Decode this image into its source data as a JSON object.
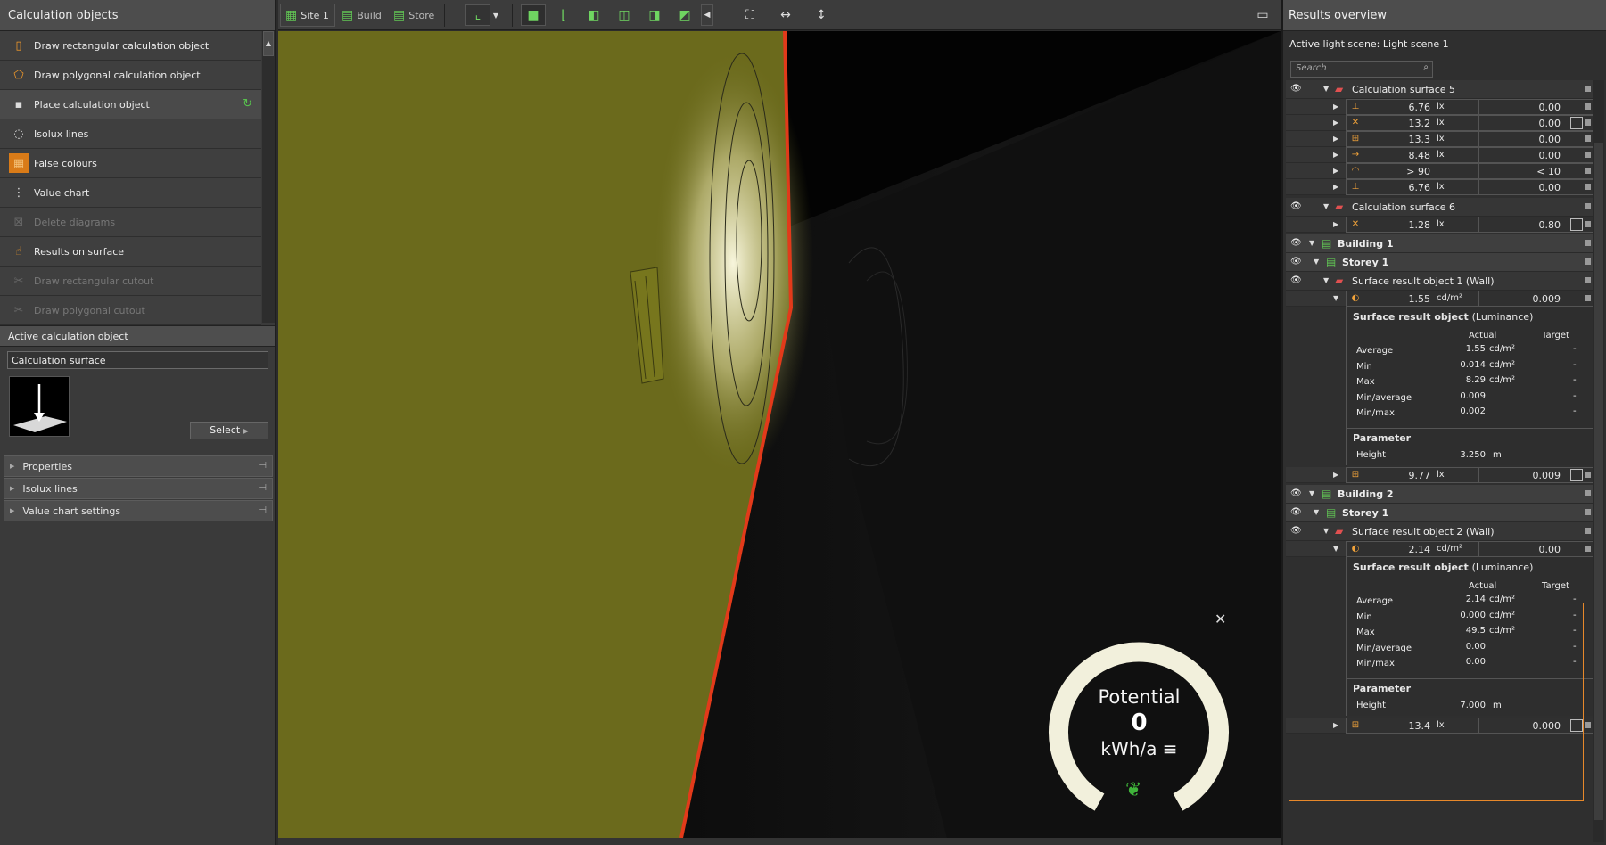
{
  "left": {
    "title": "Calculation objects",
    "tools": [
      {
        "label": "Draw rectangular calculation object",
        "icon": "rect-calc-icon",
        "enabled": true
      },
      {
        "label": "Draw polygonal calculation object",
        "icon": "polygon-calc-icon",
        "enabled": true
      },
      {
        "label": "Place calculation object",
        "icon": "place-icon",
        "enabled": true,
        "selected": true
      },
      {
        "label": "Isolux lines",
        "icon": "isolux-icon",
        "enabled": true
      },
      {
        "label": "False colours",
        "icon": "false-colours-icon",
        "enabled": true
      },
      {
        "label": "Value chart",
        "icon": "value-chart-icon",
        "enabled": true
      },
      {
        "label": "Delete diagrams",
        "icon": "delete-diagrams-icon",
        "enabled": false
      },
      {
        "label": "Results on surface",
        "icon": "results-surface-icon",
        "enabled": true
      },
      {
        "label": "Draw rectangular cutout",
        "icon": "rect-cutout-icon",
        "enabled": false
      },
      {
        "label": "Draw polygonal cutout",
        "icon": "poly-cutout-icon",
        "enabled": false
      }
    ],
    "active_title": "Active calculation object",
    "active_name": "Calculation surface",
    "select_label": "Select",
    "sections": [
      "Properties",
      "Isolux lines",
      "Value chart settings"
    ]
  },
  "toolbar": {
    "tabs": [
      "Site 1",
      "Build",
      "Store"
    ]
  },
  "right": {
    "title": "Results overview",
    "scene": "Active light scene: Light scene 1",
    "search_placeholder": "Search",
    "cs5": {
      "name": "Calculation surface 5",
      "rows": [
        {
          "v": "6.76",
          "u": "lx",
          "v2": "0.00",
          "icon": "perpendicular-icon",
          "chart": false
        },
        {
          "v": "13.2",
          "u": "lx",
          "v2": "0.00",
          "icon": "vertical-icon",
          "chart": true
        },
        {
          "v": "13.3",
          "u": "lx",
          "v2": "0.00",
          "icon": "grid-icon",
          "chart": false
        },
        {
          "v": "8.48",
          "u": "lx",
          "v2": "0.00",
          "icon": "horizontal-icon",
          "chart": false
        },
        {
          "v": "> 90",
          "u": "",
          "v2": "< 10",
          "icon": "glare-icon",
          "chart": false
        },
        {
          "v": "6.76",
          "u": "lx",
          "v2": "0.00",
          "icon": "perpendicular-icon",
          "chart": false
        }
      ]
    },
    "cs6": {
      "name": "Calculation surface 6",
      "rows": [
        {
          "v": "1.28",
          "u": "lx",
          "v2": "0.80",
          "icon": "vertical-icon",
          "chart": true
        }
      ]
    },
    "b1": {
      "building": "Building 1",
      "storey": "Storey 1",
      "object": "Surface result object 1 (Wall)",
      "lum": {
        "v": "1.55",
        "u": "cd/m²",
        "v2": "0.009"
      },
      "detail": {
        "title": "Surface result object",
        "sub": "(Luminance)",
        "actual": "Actual",
        "target": "Target",
        "rows": [
          {
            "k": "Average",
            "v": "1.55",
            "u": "cd/m²",
            "t": "-"
          },
          {
            "k": "Min",
            "v": "0.014",
            "u": "cd/m²",
            "t": "-"
          },
          {
            "k": "Max",
            "v": "8.29",
            "u": "cd/m²",
            "t": "-"
          },
          {
            "k": "Min/average",
            "v": "0.009",
            "u": "",
            "t": "-"
          },
          {
            "k": "Min/max",
            "v": "0.002",
            "u": "",
            "t": "-"
          }
        ],
        "param": "Parameter",
        "hk": "Height",
        "hv": "3.250",
        "hu": "m"
      },
      "grid": {
        "v": "9.77",
        "u": "lx",
        "v2": "0.009"
      }
    },
    "b2": {
      "building": "Building 2",
      "storey": "Storey 1",
      "object": "Surface result object 2 (Wall)",
      "lum": {
        "v": "2.14",
        "u": "cd/m²",
        "v2": "0.00"
      },
      "detail": {
        "title": "Surface result object",
        "sub": "(Luminance)",
        "actual": "Actual",
        "target": "Target",
        "rows": [
          {
            "k": "Average",
            "v": "2.14",
            "u": "cd/m²",
            "t": "-"
          },
          {
            "k": "Min",
            "v": "0.000",
            "u": "cd/m²",
            "t": "-"
          },
          {
            "k": "Max",
            "v": "49.5",
            "u": "cd/m²",
            "t": "-"
          },
          {
            "k": "Min/average",
            "v": "0.00",
            "u": "",
            "t": "-"
          },
          {
            "k": "Min/max",
            "v": "0.00",
            "u": "",
            "t": "-"
          }
        ],
        "param": "Parameter",
        "hk": "Height",
        "hv": "7.000",
        "hu": "m"
      },
      "grid": {
        "v": "13.4",
        "u": "lx",
        "v2": "0.000"
      }
    }
  },
  "gauge": {
    "title": "Potential",
    "value": "0",
    "unit": "kWh/a ≡"
  },
  "colors": {
    "accent": "#e7882a",
    "green": "#61c454",
    "wall": "#6b6a1c",
    "edge": "#e23a1a"
  }
}
